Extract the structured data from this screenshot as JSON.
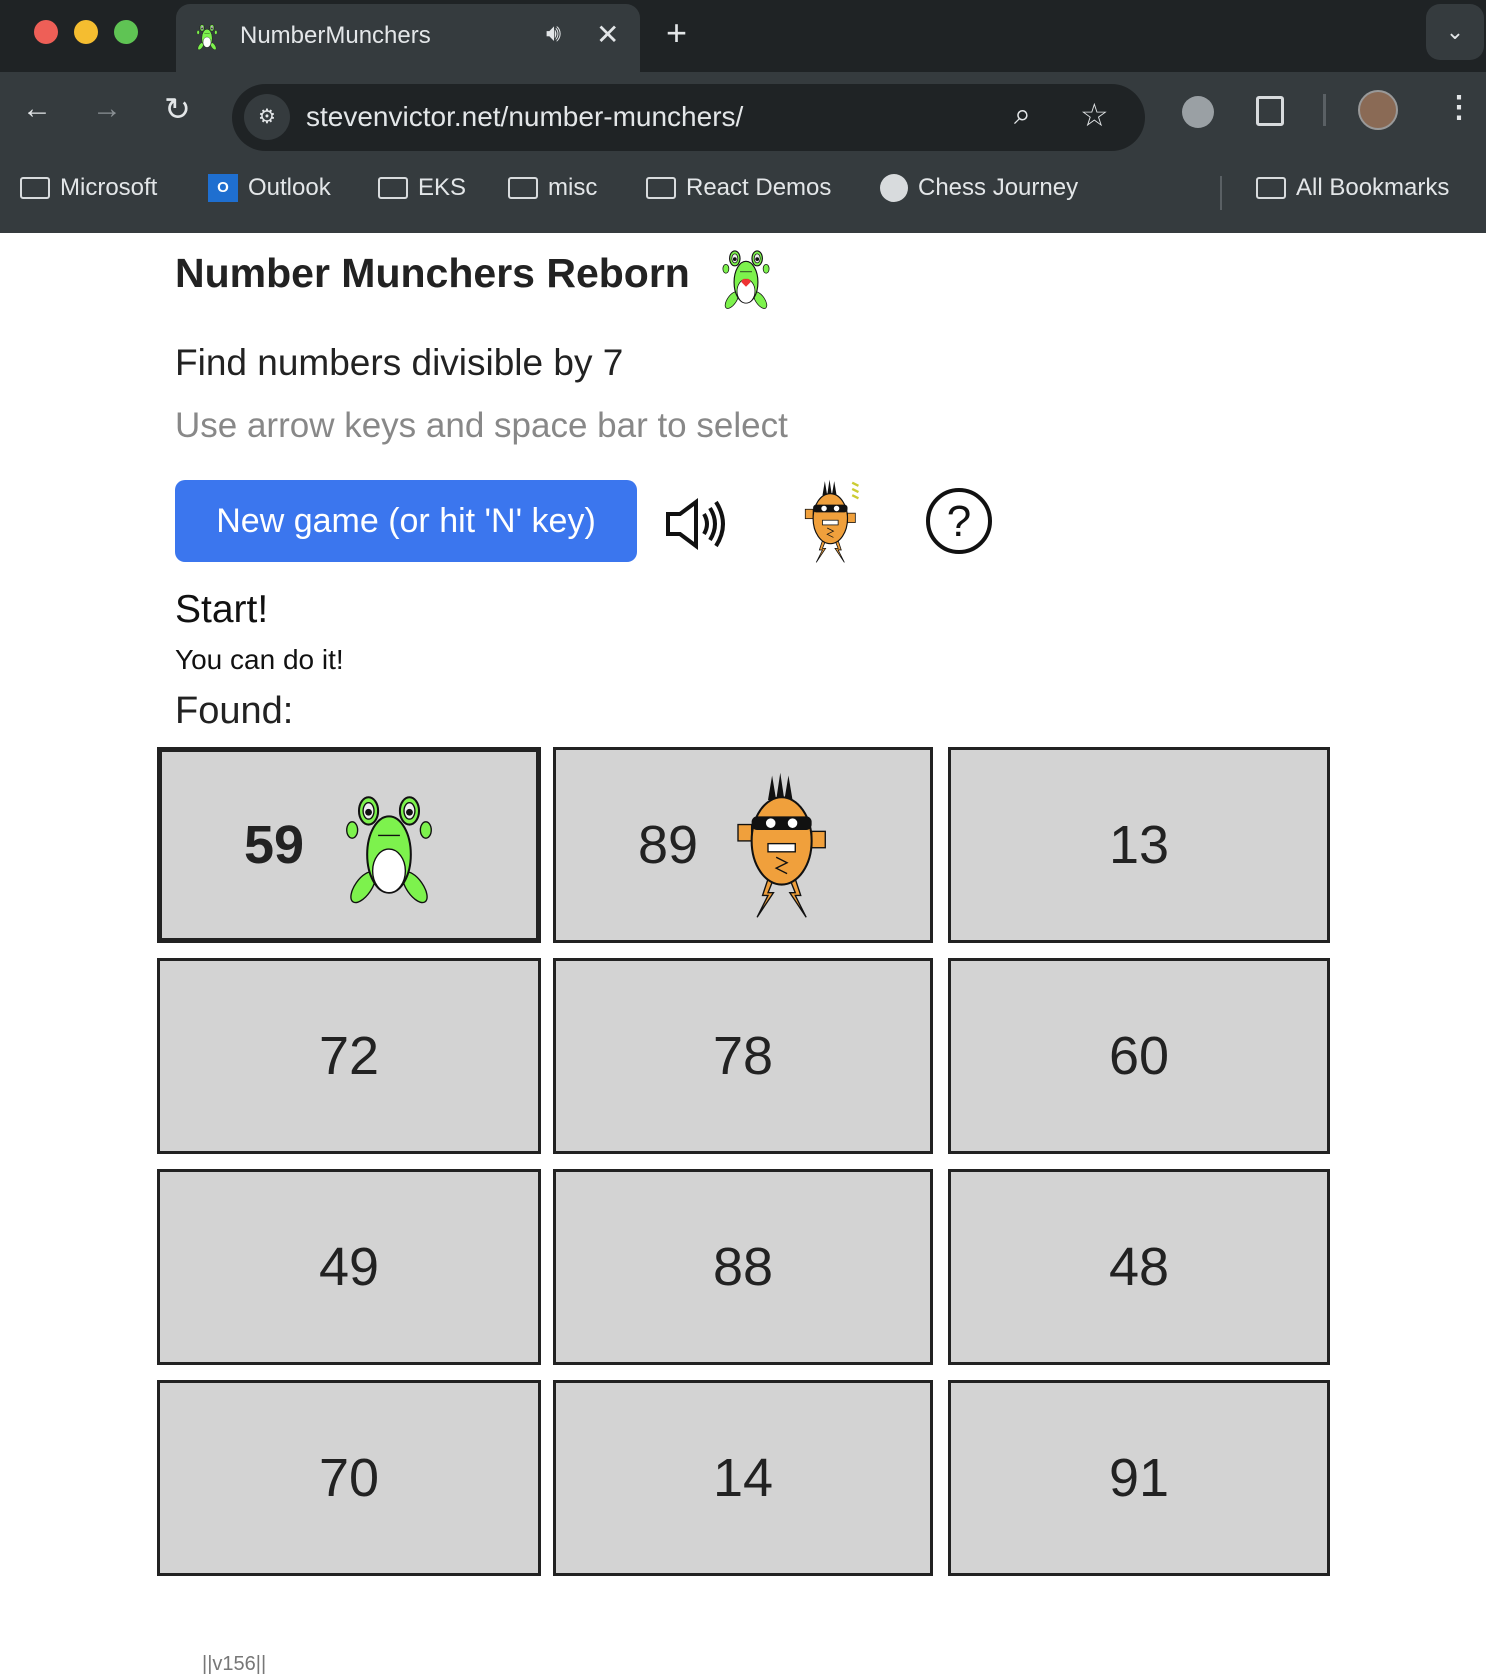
{
  "browser": {
    "tab_title": "NumberMunchers",
    "url": "stevenvictor.net/number-munchers/",
    "bookmarks": [
      {
        "label": "Microsoft",
        "icon": "folder-icon"
      },
      {
        "label": "Outlook",
        "icon": "outlook-icon"
      },
      {
        "label": "EKS",
        "icon": "folder-icon"
      },
      {
        "label": "misc",
        "icon": "folder-icon"
      },
      {
        "label": "React Demos",
        "icon": "folder-icon"
      },
      {
        "label": "Chess Journey",
        "icon": "globe-icon"
      }
    ],
    "all_bookmarks": "All Bookmarks"
  },
  "page": {
    "title": "Number Munchers Reborn",
    "rule": "Find numbers divisible by 7",
    "instructions": "Use arrow keys and space bar to select",
    "new_game_label": "New game (or hit 'N' key)",
    "status": "Start!",
    "message": "You can do it!",
    "found_label": "Found:",
    "version": "||v156||",
    "accent": "#3b76ee"
  },
  "grid": [
    {
      "value": "59",
      "frog": true,
      "muncher": false,
      "selected": true
    },
    {
      "value": "89",
      "frog": false,
      "muncher": true,
      "selected": false
    },
    {
      "value": "13"
    },
    {
      "value": "72"
    },
    {
      "value": "78"
    },
    {
      "value": "60"
    },
    {
      "value": "49"
    },
    {
      "value": "88"
    },
    {
      "value": "48"
    },
    {
      "value": "70"
    },
    {
      "value": "14"
    },
    {
      "value": "91"
    }
  ]
}
